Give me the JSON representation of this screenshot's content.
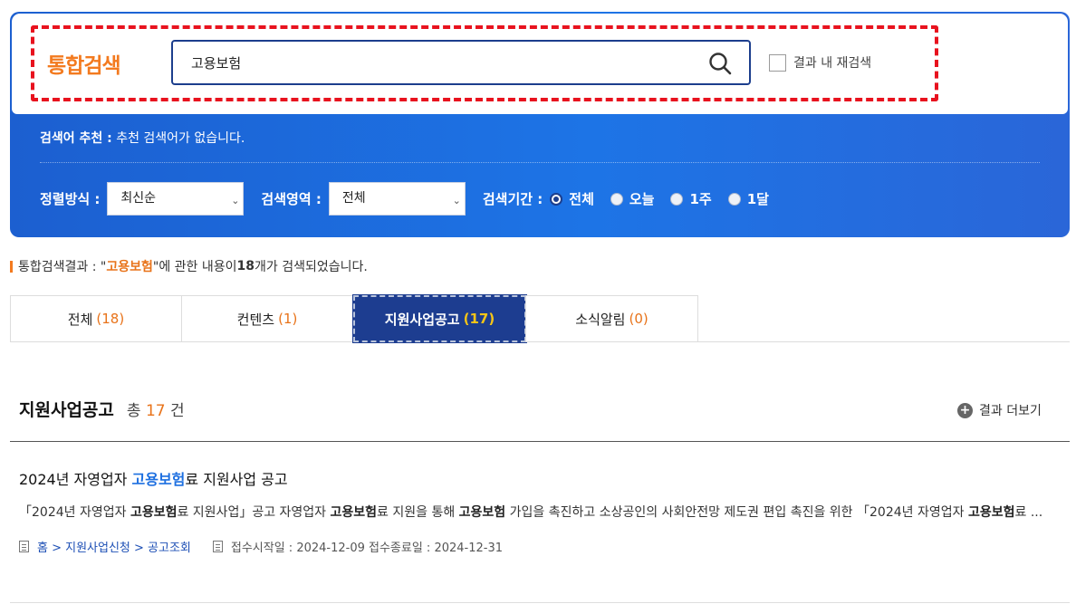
{
  "search": {
    "title": "통합검색",
    "query": "고용보험",
    "recheck_label": "결과 내 재검색",
    "recommend_label": "검색어 추천 :",
    "recommend_text": " 추천 검색어가 없습니다."
  },
  "filters": {
    "sort_label": "정렬방식 :",
    "sort_value": "최신순",
    "area_label": "검색영역 :",
    "area_value": "전체",
    "period_label": "검색기간 :",
    "periods": [
      "전체",
      "오늘",
      "1주",
      "1달"
    ],
    "selected_period": "전체"
  },
  "summary": {
    "prefix": "통합검색결과 : \"",
    "keyword": "고용보험",
    "middle": "\"에 관한 내용이 ",
    "count": "18",
    "suffix": "개가 검색되었습니다."
  },
  "tabs": [
    {
      "label": "전체",
      "count": "(18)"
    },
    {
      "label": "컨텐츠",
      "count": "(1)"
    },
    {
      "label": "지원사업공고",
      "count": "(17)"
    },
    {
      "label": "소식알림",
      "count": "(0)"
    }
  ],
  "section": {
    "title": "지원사업공고",
    "total_prefix": "총",
    "total": "17",
    "total_suffix": "건",
    "more_label": "결과 더보기"
  },
  "post": {
    "title_pre": "2024년 자영업자 ",
    "title_hl": "고용보험",
    "title_post": "료 지원사업 공고",
    "body": [
      {
        "t": "「2024년 자영업자 ",
        "b": false
      },
      {
        "t": "고용보험",
        "b": true
      },
      {
        "t": "료 지원사업」공고 자영업자 ",
        "b": false
      },
      {
        "t": "고용보험",
        "b": true
      },
      {
        "t": "료 지원을 통해 ",
        "b": false
      },
      {
        "t": "고용보험",
        "b": true
      },
      {
        "t": " 가입을 촉진하고 소상공인의 사회안전망 제도권 편입 촉진을 위한 「2024년 자영업자 ",
        "b": false
      },
      {
        "t": "고용보험",
        "b": true
      },
      {
        "t": "료 ...",
        "b": false
      }
    ],
    "breadcrumb": "홈 > 지원사업신청 > 공고조회",
    "dates": "접수시작일 : 2024-12-09 접수종료일 : 2024-12-31"
  },
  "colors": {
    "accent_orange": "#f37a1f",
    "panel_blue": "#1d74e6",
    "active_tab": "#1d3d90",
    "highlight_blue": "#1d6fe0"
  }
}
